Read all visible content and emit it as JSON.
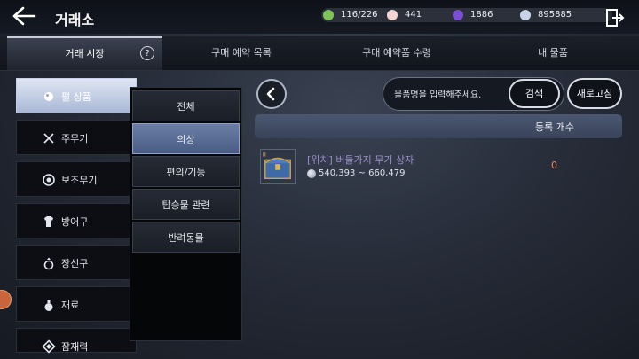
{
  "header": {
    "title": "거래소",
    "resources": [
      {
        "icon": "weight-icon",
        "value": "116/226",
        "color": "#7fc45a"
      },
      {
        "icon": "pearl-icon",
        "value": "441",
        "color": "#f2d6d6"
      },
      {
        "icon": "crystal-icon",
        "value": "1886",
        "color": "#7a4fd0"
      },
      {
        "icon": "silver-coin-icon",
        "value": "895885",
        "color": "#c8d4e6"
      }
    ]
  },
  "tabs": [
    {
      "label": "거래 시장",
      "active": true
    },
    {
      "label": "구매 예약 목록"
    },
    {
      "label": "구매 예약품 수령"
    },
    {
      "label": "내 물품"
    }
  ],
  "help_label": "?",
  "categories": [
    {
      "label": "펄 상품",
      "icon": "pearl-icon",
      "active": true
    },
    {
      "label": "주무기",
      "icon": "crossed-swords-icon"
    },
    {
      "label": "보조무기",
      "icon": "shield-icon"
    },
    {
      "label": "방어구",
      "icon": "armor-icon"
    },
    {
      "label": "장신구",
      "icon": "ring-icon"
    },
    {
      "label": "재료",
      "icon": "potion-icon"
    },
    {
      "label": "잠재력",
      "icon": "diamond-icon"
    }
  ],
  "subcategories": [
    {
      "label": "전체"
    },
    {
      "label": "의상",
      "active": true
    },
    {
      "label": "편의/기능"
    },
    {
      "label": "탑승물 관련"
    },
    {
      "label": "반려동물"
    }
  ],
  "search": {
    "placeholder": "물품명을 입력해주세요.",
    "search_label": "검색",
    "refresh_label": "새로고침"
  },
  "list": {
    "column_header": "등록 개수",
    "items": [
      {
        "name": "[위치] 버들가지 무기 상자",
        "price_range": "540,393 ~ 660,479",
        "count": "0"
      }
    ]
  },
  "colors": {
    "accent": "#4a5c84",
    "item_name": "#9a8fc8",
    "count": "#e98a5a"
  }
}
